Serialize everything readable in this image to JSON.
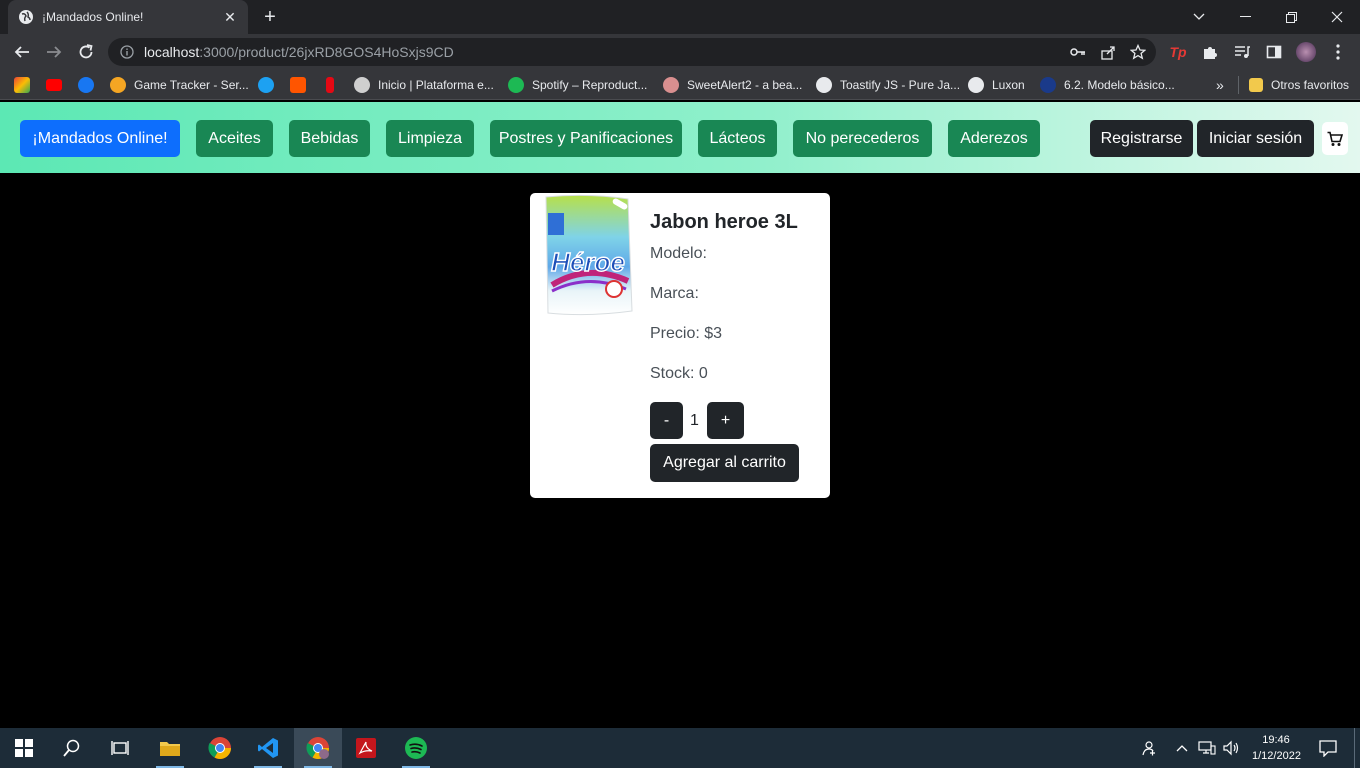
{
  "browser": {
    "tab_title": "¡Mandados Online!",
    "tab_close": "✕",
    "new_tab": "+",
    "url_host": "localhost",
    "url_path": ":3000/product/26jxRD8GOS4HoSxjs9CD",
    "bookmarks": [
      {
        "label": "",
        "icon": "gmail-icon",
        "color": "#ea4335"
      },
      {
        "label": "",
        "icon": "youtube-icon",
        "color": "#ff0000"
      },
      {
        "label": "",
        "icon": "facebook-icon",
        "color": "#1877f2"
      },
      {
        "label": "Game Tracker - Ser...",
        "icon": "gametracker-icon",
        "color": "#f5a623"
      },
      {
        "label": "",
        "icon": "twitter-icon",
        "color": "#1da1f2"
      },
      {
        "label": "",
        "icon": "soundcloud-icon",
        "color": "#ff5500"
      },
      {
        "label": "",
        "icon": "netflix-icon",
        "color": "#e50914"
      },
      {
        "label": "Inicio | Plataforma e...",
        "icon": "platform-icon",
        "color": "#cfcfcf"
      },
      {
        "label": "Spotify – Reproduct...",
        "icon": "spotify-icon",
        "color": "#1db954"
      },
      {
        "label": "SweetAlert2 - a bea...",
        "icon": "sweetalert-icon",
        "color": "#d98f8f"
      },
      {
        "label": "Toastify JS - Pure Ja...",
        "icon": "globe-icon",
        "color": "#e8eaed"
      },
      {
        "label": "Luxon",
        "icon": "globe-icon",
        "color": "#e8eaed"
      },
      {
        "label": "6.2. Modelo básico...",
        "icon": "doc-icon",
        "color": "#1a3a8a"
      }
    ],
    "bookmarks_overflow": "»",
    "other_bookmarks": "Otros favoritos"
  },
  "navbar": {
    "brand": "¡Mandados Online!",
    "categories": [
      "Aceites",
      "Bebidas",
      "Limpieza",
      "Postres y Panificaciones",
      "Lácteos",
      "No perecederos",
      "Aderezos"
    ],
    "register": "Registrarse",
    "login": "Iniciar sesión"
  },
  "product": {
    "image_alt": "Héroe",
    "name": "Jabon heroe 3L",
    "model_line": "Modelo:",
    "brand_line": "Marca:",
    "price_line": "Precio: $3",
    "stock_line": "Stock: 0",
    "qty_minus": "-",
    "qty_value": "1",
    "qty_plus": "+",
    "add_to_cart": "Agregar al carrito"
  },
  "taskbar": {
    "time": "19:46",
    "date": "1/12/2022"
  }
}
